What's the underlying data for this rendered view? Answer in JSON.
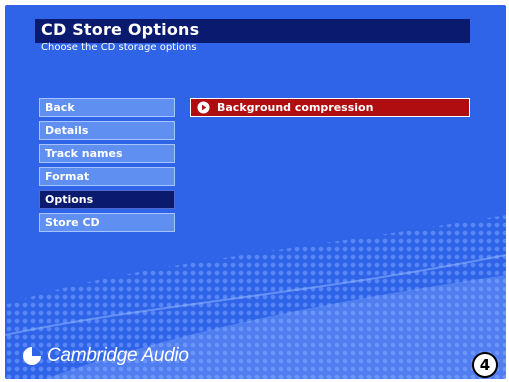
{
  "header": {
    "title": "CD Store Options",
    "subtitle": "Choose the CD storage options"
  },
  "menu": {
    "items": [
      {
        "label": "Back"
      },
      {
        "label": "Details"
      },
      {
        "label": "Track names"
      },
      {
        "label": "Format"
      },
      {
        "label": "Options",
        "selected": true
      },
      {
        "label": "Store CD"
      }
    ]
  },
  "options": {
    "items": [
      {
        "label": "Background compression",
        "icon": "play-circle-icon"
      }
    ]
  },
  "brand": {
    "name": "Cambridge Audio",
    "icon": "cambridge-audio-logo-icon"
  },
  "page_marker": "4",
  "colors": {
    "background": "#2f63e8",
    "header_bar": "#0a1a6e",
    "menu_item": "#5f8ff0",
    "menu_selected": "#0a1a6e",
    "option_highlight": "#b00d10"
  }
}
